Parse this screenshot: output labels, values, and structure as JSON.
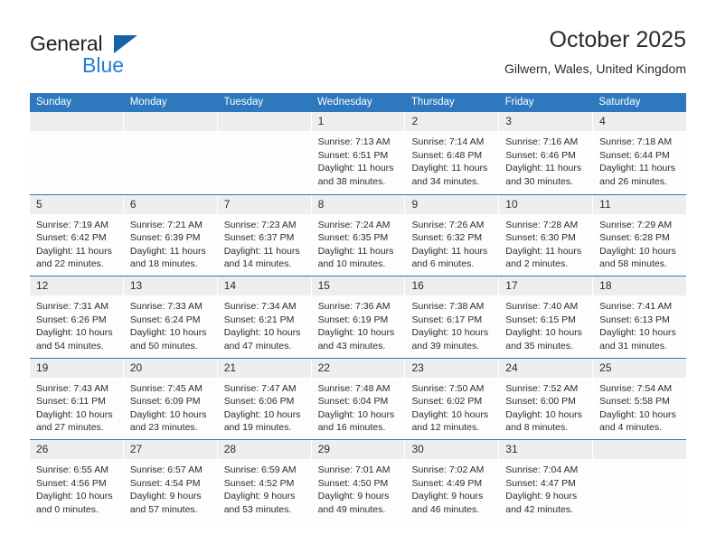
{
  "brand": {
    "name_part1": "General",
    "name_part2": "Blue",
    "triangle_color": "#1464aa",
    "blue_text_color": "#1e7fd4"
  },
  "header": {
    "title": "October 2025",
    "subtitle": "Gilwern, Wales, United Kingdom",
    "header_bg_color": "#2e79bd",
    "header_text_color": "#ffffff"
  },
  "weekdays": [
    "Sunday",
    "Monday",
    "Tuesday",
    "Wednesday",
    "Thursday",
    "Friday",
    "Saturday"
  ],
  "weeks": [
    [
      {
        "day": "",
        "sunrise": "",
        "sunset": "",
        "daylight_line1": "",
        "daylight_line2": "",
        "empty": true
      },
      {
        "day": "",
        "sunrise": "",
        "sunset": "",
        "daylight_line1": "",
        "daylight_line2": "",
        "empty": true
      },
      {
        "day": "",
        "sunrise": "",
        "sunset": "",
        "daylight_line1": "",
        "daylight_line2": "",
        "empty": true
      },
      {
        "day": "1",
        "sunrise": "Sunrise: 7:13 AM",
        "sunset": "Sunset: 6:51 PM",
        "daylight_line1": "Daylight: 11 hours",
        "daylight_line2": "and 38 minutes."
      },
      {
        "day": "2",
        "sunrise": "Sunrise: 7:14 AM",
        "sunset": "Sunset: 6:48 PM",
        "daylight_line1": "Daylight: 11 hours",
        "daylight_line2": "and 34 minutes."
      },
      {
        "day": "3",
        "sunrise": "Sunrise: 7:16 AM",
        "sunset": "Sunset: 6:46 PM",
        "daylight_line1": "Daylight: 11 hours",
        "daylight_line2": "and 30 minutes."
      },
      {
        "day": "4",
        "sunrise": "Sunrise: 7:18 AM",
        "sunset": "Sunset: 6:44 PM",
        "daylight_line1": "Daylight: 11 hours",
        "daylight_line2": "and 26 minutes."
      }
    ],
    [
      {
        "day": "5",
        "sunrise": "Sunrise: 7:19 AM",
        "sunset": "Sunset: 6:42 PM",
        "daylight_line1": "Daylight: 11 hours",
        "daylight_line2": "and 22 minutes."
      },
      {
        "day": "6",
        "sunrise": "Sunrise: 7:21 AM",
        "sunset": "Sunset: 6:39 PM",
        "daylight_line1": "Daylight: 11 hours",
        "daylight_line2": "and 18 minutes."
      },
      {
        "day": "7",
        "sunrise": "Sunrise: 7:23 AM",
        "sunset": "Sunset: 6:37 PM",
        "daylight_line1": "Daylight: 11 hours",
        "daylight_line2": "and 14 minutes."
      },
      {
        "day": "8",
        "sunrise": "Sunrise: 7:24 AM",
        "sunset": "Sunset: 6:35 PM",
        "daylight_line1": "Daylight: 11 hours",
        "daylight_line2": "and 10 minutes."
      },
      {
        "day": "9",
        "sunrise": "Sunrise: 7:26 AM",
        "sunset": "Sunset: 6:32 PM",
        "daylight_line1": "Daylight: 11 hours",
        "daylight_line2": "and 6 minutes."
      },
      {
        "day": "10",
        "sunrise": "Sunrise: 7:28 AM",
        "sunset": "Sunset: 6:30 PM",
        "daylight_line1": "Daylight: 11 hours",
        "daylight_line2": "and 2 minutes."
      },
      {
        "day": "11",
        "sunrise": "Sunrise: 7:29 AM",
        "sunset": "Sunset: 6:28 PM",
        "daylight_line1": "Daylight: 10 hours",
        "daylight_line2": "and 58 minutes."
      }
    ],
    [
      {
        "day": "12",
        "sunrise": "Sunrise: 7:31 AM",
        "sunset": "Sunset: 6:26 PM",
        "daylight_line1": "Daylight: 10 hours",
        "daylight_line2": "and 54 minutes."
      },
      {
        "day": "13",
        "sunrise": "Sunrise: 7:33 AM",
        "sunset": "Sunset: 6:24 PM",
        "daylight_line1": "Daylight: 10 hours",
        "daylight_line2": "and 50 minutes."
      },
      {
        "day": "14",
        "sunrise": "Sunrise: 7:34 AM",
        "sunset": "Sunset: 6:21 PM",
        "daylight_line1": "Daylight: 10 hours",
        "daylight_line2": "and 47 minutes."
      },
      {
        "day": "15",
        "sunrise": "Sunrise: 7:36 AM",
        "sunset": "Sunset: 6:19 PM",
        "daylight_line1": "Daylight: 10 hours",
        "daylight_line2": "and 43 minutes."
      },
      {
        "day": "16",
        "sunrise": "Sunrise: 7:38 AM",
        "sunset": "Sunset: 6:17 PM",
        "daylight_line1": "Daylight: 10 hours",
        "daylight_line2": "and 39 minutes."
      },
      {
        "day": "17",
        "sunrise": "Sunrise: 7:40 AM",
        "sunset": "Sunset: 6:15 PM",
        "daylight_line1": "Daylight: 10 hours",
        "daylight_line2": "and 35 minutes."
      },
      {
        "day": "18",
        "sunrise": "Sunrise: 7:41 AM",
        "sunset": "Sunset: 6:13 PM",
        "daylight_line1": "Daylight: 10 hours",
        "daylight_line2": "and 31 minutes."
      }
    ],
    [
      {
        "day": "19",
        "sunrise": "Sunrise: 7:43 AM",
        "sunset": "Sunset: 6:11 PM",
        "daylight_line1": "Daylight: 10 hours",
        "daylight_line2": "and 27 minutes."
      },
      {
        "day": "20",
        "sunrise": "Sunrise: 7:45 AM",
        "sunset": "Sunset: 6:09 PM",
        "daylight_line1": "Daylight: 10 hours",
        "daylight_line2": "and 23 minutes."
      },
      {
        "day": "21",
        "sunrise": "Sunrise: 7:47 AM",
        "sunset": "Sunset: 6:06 PM",
        "daylight_line1": "Daylight: 10 hours",
        "daylight_line2": "and 19 minutes."
      },
      {
        "day": "22",
        "sunrise": "Sunrise: 7:48 AM",
        "sunset": "Sunset: 6:04 PM",
        "daylight_line1": "Daylight: 10 hours",
        "daylight_line2": "and 16 minutes."
      },
      {
        "day": "23",
        "sunrise": "Sunrise: 7:50 AM",
        "sunset": "Sunset: 6:02 PM",
        "daylight_line1": "Daylight: 10 hours",
        "daylight_line2": "and 12 minutes."
      },
      {
        "day": "24",
        "sunrise": "Sunrise: 7:52 AM",
        "sunset": "Sunset: 6:00 PM",
        "daylight_line1": "Daylight: 10 hours",
        "daylight_line2": "and 8 minutes."
      },
      {
        "day": "25",
        "sunrise": "Sunrise: 7:54 AM",
        "sunset": "Sunset: 5:58 PM",
        "daylight_line1": "Daylight: 10 hours",
        "daylight_line2": "and 4 minutes."
      }
    ],
    [
      {
        "day": "26",
        "sunrise": "Sunrise: 6:55 AM",
        "sunset": "Sunset: 4:56 PM",
        "daylight_line1": "Daylight: 10 hours",
        "daylight_line2": "and 0 minutes."
      },
      {
        "day": "27",
        "sunrise": "Sunrise: 6:57 AM",
        "sunset": "Sunset: 4:54 PM",
        "daylight_line1": "Daylight: 9 hours",
        "daylight_line2": "and 57 minutes."
      },
      {
        "day": "28",
        "sunrise": "Sunrise: 6:59 AM",
        "sunset": "Sunset: 4:52 PM",
        "daylight_line1": "Daylight: 9 hours",
        "daylight_line2": "and 53 minutes."
      },
      {
        "day": "29",
        "sunrise": "Sunrise: 7:01 AM",
        "sunset": "Sunset: 4:50 PM",
        "daylight_line1": "Daylight: 9 hours",
        "daylight_line2": "and 49 minutes."
      },
      {
        "day": "30",
        "sunrise": "Sunrise: 7:02 AM",
        "sunset": "Sunset: 4:49 PM",
        "daylight_line1": "Daylight: 9 hours",
        "daylight_line2": "and 46 minutes."
      },
      {
        "day": "31",
        "sunrise": "Sunrise: 7:04 AM",
        "sunset": "Sunset: 4:47 PM",
        "daylight_line1": "Daylight: 9 hours",
        "daylight_line2": "and 42 minutes."
      },
      {
        "day": "",
        "sunrise": "",
        "sunset": "",
        "daylight_line1": "",
        "daylight_line2": "",
        "empty": true
      }
    ]
  ]
}
